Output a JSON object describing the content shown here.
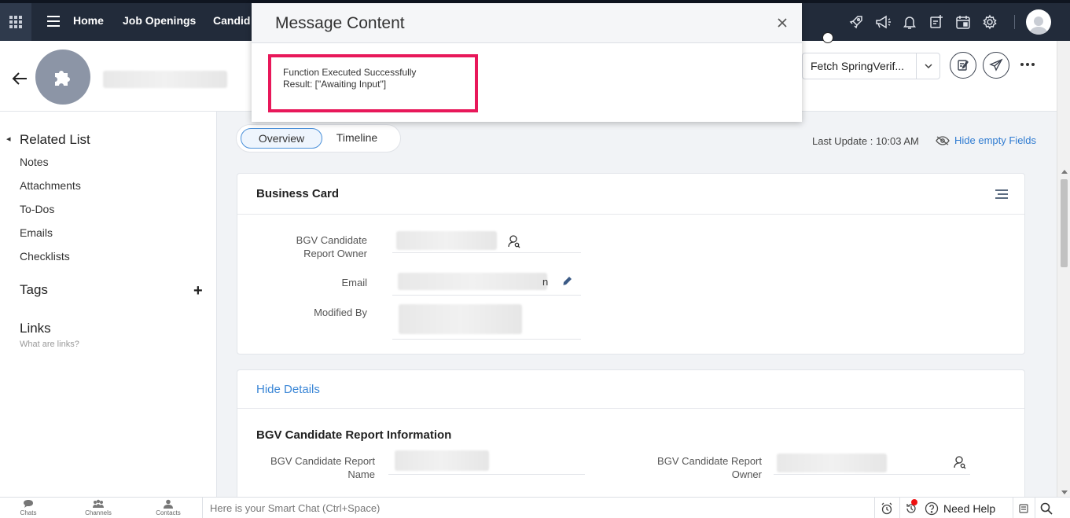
{
  "topnav": {
    "items": [
      "Home",
      "Job Openings",
      "Candid"
    ]
  },
  "header": {
    "fetch_button_label": "Fetch SpringVerif..."
  },
  "left_panel": {
    "related_list_title": "Related List",
    "related_items": [
      "Notes",
      "Attachments",
      "To-Dos",
      "Emails",
      "Checklists"
    ],
    "tags_title": "Tags",
    "tags_add": "+",
    "links_title": "Links",
    "links_hint": "What are links?"
  },
  "tabs": {
    "overview": "Overview",
    "timeline": "Timeline"
  },
  "meta": {
    "last_update": "Last Update : 10:03 AM",
    "hide_empty": "Hide empty Fields"
  },
  "business_card": {
    "title": "Business Card",
    "owner_label_line1": "BGV Candidate",
    "owner_label_line2": "Report Owner",
    "email_label": "Email",
    "email_suffix": "n",
    "modified_label": "Modified By"
  },
  "details": {
    "hide_details": "Hide Details",
    "section_title": "BGV Candidate Report Information",
    "name_label_line1": "BGV Candidate Report",
    "name_label_line2": "Name",
    "owner_label_line1": "BGV Candidate Report",
    "owner_label_line2": "Owner"
  },
  "bottom_bar": {
    "chats": "Chats",
    "channels": "Channels",
    "contacts": "Contacts",
    "smart_chat_placeholder": "Here is your Smart Chat (Ctrl+Space)",
    "need_help": "Need Help"
  },
  "modal": {
    "title": "Message Content",
    "line1": "Function Executed Successfully",
    "line2": "Result: [\"Awaiting Input\"]"
  },
  "colors": {
    "topbar": "#222b3a",
    "accent_link": "#2f7bd1",
    "highlight_border": "#e8185a"
  }
}
